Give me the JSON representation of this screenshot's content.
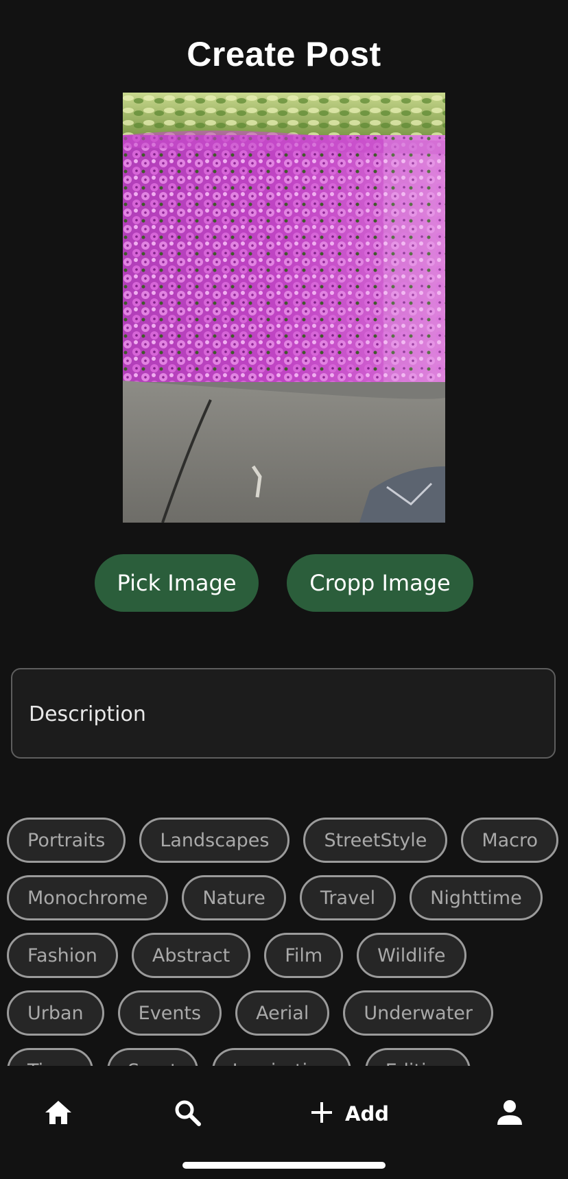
{
  "header": {
    "title": "Create Post"
  },
  "preview": {
    "subject": "pink petunia flower bed photo"
  },
  "actions": {
    "pick_label": "Pick Image",
    "crop_label": "Cropp Image"
  },
  "description": {
    "placeholder": "Description",
    "value": ""
  },
  "tags": [
    "Portraits",
    "Landscapes",
    "StreetStyle",
    "Macro",
    "Monochrome",
    "Nature",
    "Travel",
    "Nighttime",
    "Fashion",
    "Abstract",
    "Film",
    "Wildlife",
    "Urban",
    "Events",
    "Aerial",
    "Underwater",
    "Time",
    "Sport",
    "Inspiration",
    "Editing"
  ],
  "nav": {
    "items": [
      {
        "name": "home",
        "icon": "home-icon",
        "label": ""
      },
      {
        "name": "search",
        "icon": "search-icon",
        "label": ""
      },
      {
        "name": "add",
        "icon": "plus-icon",
        "label": "Add"
      },
      {
        "name": "profile",
        "icon": "person-icon",
        "label": ""
      }
    ]
  },
  "colors": {
    "background": "#121212",
    "button": "#2b5e3b",
    "chip_border": "#9b9b9b",
    "chip_text": "#a9a9a9"
  }
}
